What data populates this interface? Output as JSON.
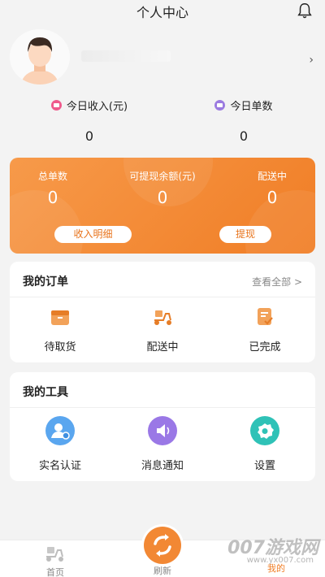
{
  "header": {
    "title": "个人中心",
    "icon": "bell-icon"
  },
  "stats": {
    "income_label": "今日收入(元)",
    "income_value": "0",
    "orders_label": "今日单数",
    "orders_value": "0",
    "income_color": "#ef5a8c",
    "orders_color": "#9b7be0"
  },
  "summary": {
    "total_orders_label": "总单数",
    "total_orders_value": "0",
    "withdrawable_label": "可提现余额(元)",
    "withdrawable_value": "0",
    "delivering_label": "配送中",
    "delivering_value": "0",
    "income_detail_button": "收入明细",
    "withdraw_button": "提现",
    "accent": "#f07d25"
  },
  "orders": {
    "title": "我的订单",
    "view_all": "查看全部 >",
    "items": [
      {
        "label": "待取货",
        "icon": "package-icon"
      },
      {
        "label": "配送中",
        "icon": "scooter-icon"
      },
      {
        "label": "已完成",
        "icon": "check-document-icon"
      }
    ]
  },
  "tools": {
    "title": "我的工具",
    "items": [
      {
        "label": "实名认证",
        "icon": "user-verify-icon",
        "color": "#5aa6ef"
      },
      {
        "label": "消息通知",
        "icon": "speaker-icon",
        "color": "#9a78e6"
      },
      {
        "label": "设置",
        "icon": "gear-icon",
        "color": "#2fc2b7"
      }
    ]
  },
  "tabbar": {
    "home_label": "首页",
    "refresh_label": "刷新",
    "mine_label": "我的"
  },
  "watermark": {
    "text": "007游戏网",
    "url": "www.yx007.com"
  }
}
